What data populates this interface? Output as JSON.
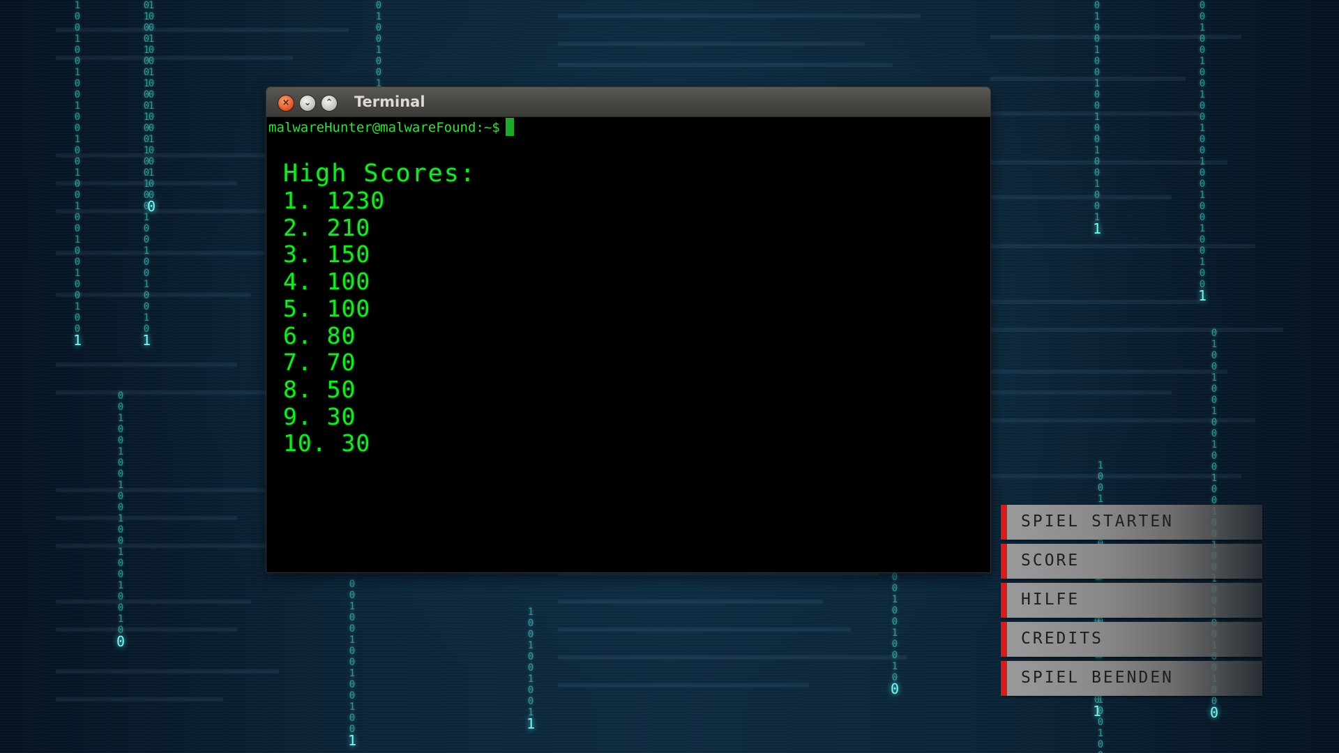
{
  "window": {
    "title": "Terminal",
    "close_glyph": "×",
    "minimize_glyph": "⌄",
    "maximize_glyph": "⌃"
  },
  "terminal": {
    "prompt": "malwareHunter@malwareFound:~$",
    "high_scores_title": "High Scores:",
    "scores": [
      {
        "rank": "1.",
        "score": "1230"
      },
      {
        "rank": "2.",
        "score": "210"
      },
      {
        "rank": "3.",
        "score": "150"
      },
      {
        "rank": "4.",
        "score": "100"
      },
      {
        "rank": "5.",
        "score": "100"
      },
      {
        "rank": "6.",
        "score": "80"
      },
      {
        "rank": "7.",
        "score": "70"
      },
      {
        "rank": "8.",
        "score": "50"
      },
      {
        "rank": "9.",
        "score": "30"
      },
      {
        "rank": "10.",
        "score": "30"
      }
    ]
  },
  "menu": {
    "items": [
      {
        "label": "SPIEL STARTEN"
      },
      {
        "label": "SCORE"
      },
      {
        "label": "HILFE"
      },
      {
        "label": "CREDITS"
      },
      {
        "label": "SPIEL BEENDEN"
      }
    ]
  },
  "colors": {
    "terminal_text": "#1ee32b",
    "menu_accent": "#d61d1d",
    "background": "#0a1a2a"
  }
}
